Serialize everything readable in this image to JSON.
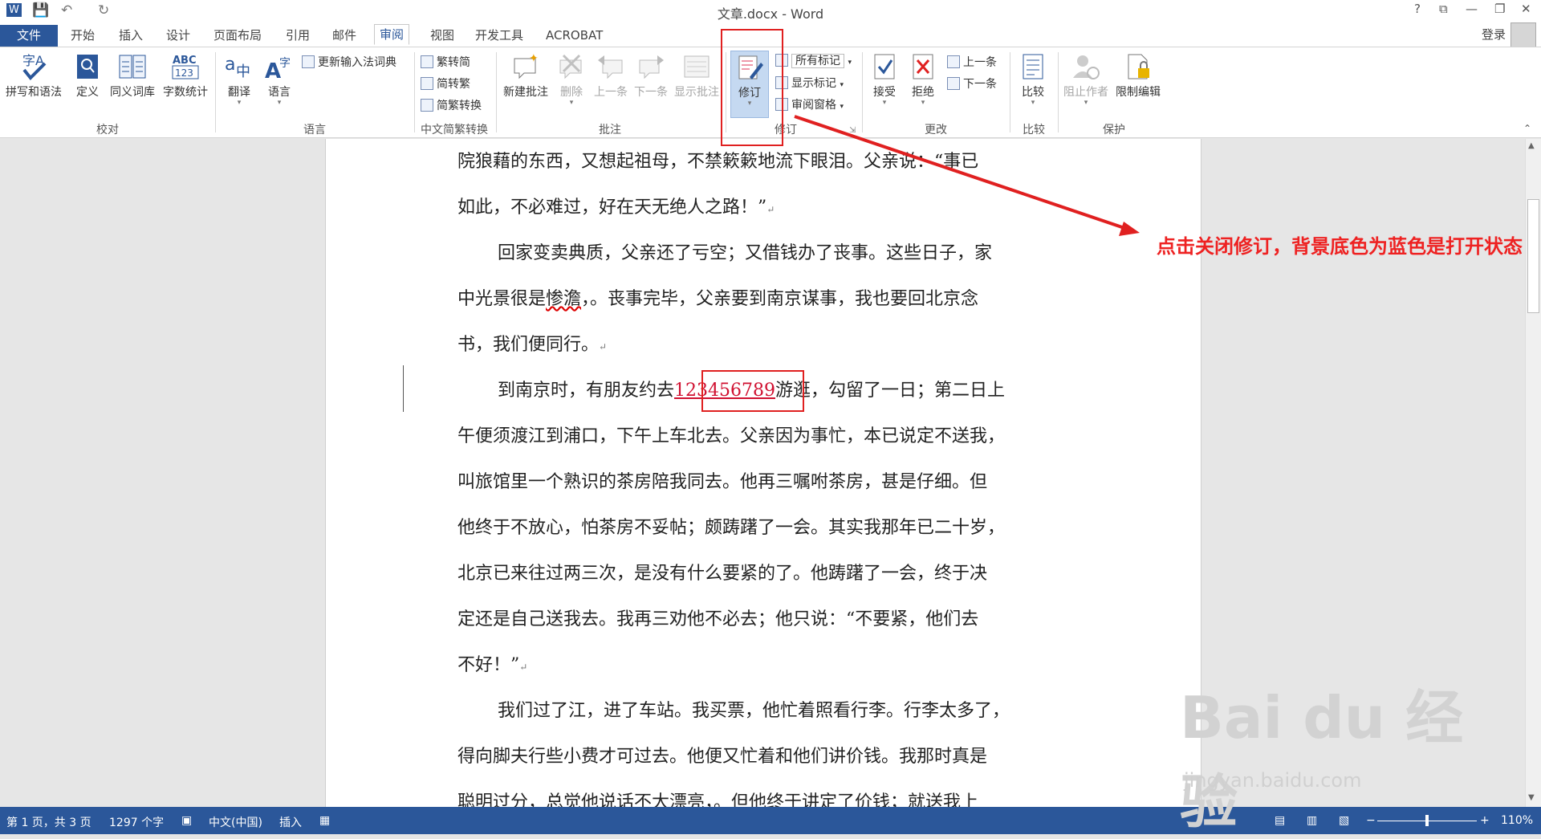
{
  "window": {
    "title": "文章.docx - Word"
  },
  "quick_access": {
    "undo": "↶",
    "redo": "↻",
    "save": "💾"
  },
  "window_controls": {
    "help": "?",
    "restore_ribbon": "⧉",
    "restore": "❐",
    "minimize": "—",
    "close": "✕"
  },
  "tabs": [
    "文件",
    "开始",
    "插入",
    "设计",
    "页面布局",
    "引用",
    "邮件",
    "审阅",
    "视图",
    "开发工具",
    "ACROBAT"
  ],
  "active_tab": "审阅",
  "account": {
    "login": "登录"
  },
  "ribbon": {
    "proofing": {
      "group": "校对",
      "spelling": "拼写和语法",
      "define": "定义",
      "thesaurus": "同义词库",
      "wordcount": "字数统计"
    },
    "language": {
      "group": "语言",
      "translate": "翻译",
      "language": "语言",
      "ime_dict": "更新输入法词典"
    },
    "chinese": {
      "group": "中文简繁转换",
      "to_simplified": "繁转简",
      "to_traditional": "简转繁",
      "convert": "简繁转换"
    },
    "comments": {
      "group": "批注",
      "new": "新建批注",
      "delete": "删除",
      "prev": "上一条",
      "next": "下一条",
      "show": "显示批注"
    },
    "tracking": {
      "group": "修订",
      "track": "修订",
      "all_markup": "所有标记",
      "show_markup": "显示标记",
      "pane": "审阅窗格"
    },
    "changes": {
      "group": "更改",
      "accept": "接受",
      "reject": "拒绝",
      "prev": "上一条",
      "next": "下一条"
    },
    "compare": {
      "group": "比较",
      "compare": "比较"
    },
    "protect": {
      "group": "保护",
      "block_authors": "阻止作者",
      "restrict": "限制编辑"
    }
  },
  "document": {
    "lines": [
      "院狼藉的东西，又想起祖母，不禁簌簌地流下眼泪。父亲说：“事已",
      "如此，不必难过，好在天无绝人之路！”",
      "回家变卖典质，父亲还了亏空；又借钱办了丧事。这些日子，家",
      "中光景很是",
      "惨澹",
      "，。丧事完毕，父亲要到南京谋事，我也要回北京念",
      "书，我们便同行。",
      "到南京时，有朋友约去",
      "123456789",
      "游逛，勾留了一日；第二日上",
      "午便须渡江到浦口，下午上车北去。父亲因为事忙，本已说定不送我，",
      "叫旅馆里一个熟识的茶房陪我同去。他再三嘱咐茶房，甚是仔细。但",
      "他终于不放心，怕茶房不妥帖；颇踌躇了一会。其实我那年已二十岁，",
      "北京已来往过两三次，是没有什么要紧的了。他踌躇了一会，终于决",
      "定还是自己送我去。我再三劝他不必去；他只说：“不要紧，他们去",
      "不好！”",
      "我们过了江，进了车站。我买票，他忙着照看行李。行李太多了，",
      "得向脚夫行些小费才可过去。他便又忙着和他们讲价钱。我那时真是",
      "聪明过分，总觉他说话不大漂亮，。但他终于讲定了价钱；就送我上"
    ],
    "para_mark": "↵"
  },
  "annotation": {
    "note": "点击关闭修订，背景底色为蓝色是打开状态"
  },
  "watermark": {
    "brand": "Bai du 经验",
    "site": "jingyan.baidu.com"
  },
  "status_bar": {
    "page": "第 1 页，共 3 页",
    "words": "1297 个字",
    "language": "中文(中国)",
    "mode": "插入",
    "zoom": "110%"
  },
  "colors": {
    "accent": "#2b579a",
    "annotation": "#e02020",
    "revision": "#d01030"
  }
}
